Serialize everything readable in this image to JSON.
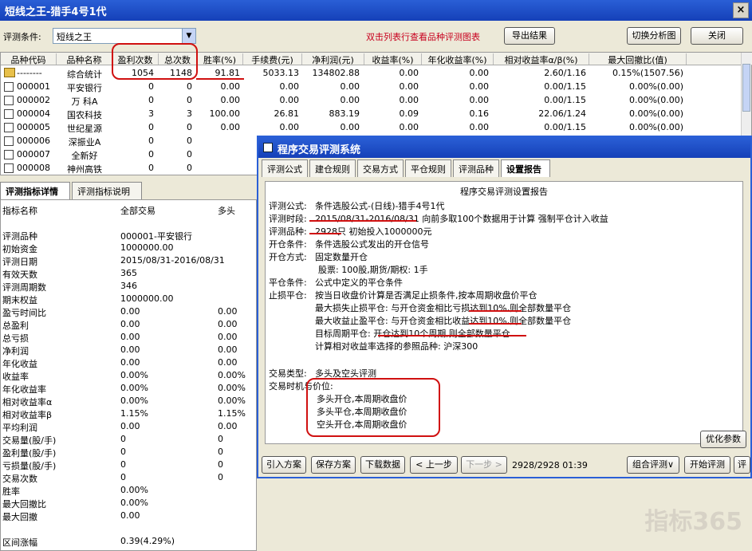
{
  "window": {
    "title": "短线之王-猎手4号1代",
    "close_icon": "×"
  },
  "toolbar": {
    "condition_label": "评测条件:",
    "condition_value": "短线之王",
    "hint": "双击列表行查看品种评测图表",
    "export_label": "导出结果",
    "switch_label": "切换分析图",
    "close_label": "关闭"
  },
  "grid": {
    "headers": [
      "品种代码",
      "品种名称",
      "盈利次数",
      "总次数",
      "胜率(%)",
      "手续费(元)",
      "净利润(元)",
      "收益率(%)",
      "年化收益率(%)",
      "相对收益率α/β(%)",
      "最大回撤比(值)"
    ],
    "rows": [
      [
        "--------",
        "综合统计",
        "1054",
        "1148",
        "91.81",
        "5033.13",
        "134802.88",
        "0.00",
        "0.00",
        "2.60/1.16",
        "0.15%(1507.56)"
      ],
      [
        "000001",
        "平安银行",
        "0",
        "0",
        "0.00",
        "0.00",
        "0.00",
        "0.00",
        "0.00",
        "0.00/1.15",
        "0.00%(0.00)"
      ],
      [
        "000002",
        "万 科A",
        "0",
        "0",
        "0.00",
        "0.00",
        "0.00",
        "0.00",
        "0.00",
        "0.00/1.15",
        "0.00%(0.00)"
      ],
      [
        "000004",
        "国农科技",
        "3",
        "3",
        "100.00",
        "26.81",
        "883.19",
        "0.09",
        "0.16",
        "22.06/1.24",
        "0.00%(0.00)"
      ],
      [
        "000005",
        "世纪星源",
        "0",
        "0",
        "0.00",
        "0.00",
        "0.00",
        "0.00",
        "0.00",
        "0.00/1.15",
        "0.00%(0.00)"
      ],
      [
        "000006",
        "深振业A",
        "0",
        "0",
        "",
        "",
        "",
        "",
        "",
        "",
        ""
      ],
      [
        "000007",
        "全新好",
        "0",
        "0",
        "",
        "",
        "",
        "",
        "",
        "",
        ""
      ],
      [
        "000008",
        "神州高铁",
        "0",
        "0",
        "",
        "",
        "",
        "",
        "",
        "",
        ""
      ]
    ]
  },
  "lower_tabs": [
    "评测指标详情",
    "评测指标说明"
  ],
  "detail": {
    "headers": [
      "指标名称",
      "全部交易",
      "多头"
    ],
    "rows": [
      [
        "评测品种",
        "000001-平安银行",
        ""
      ],
      [
        "初始资金",
        "1000000.00",
        ""
      ],
      [
        "评测日期",
        "2015/08/31-2016/08/31",
        ""
      ],
      [
        "有效天数",
        "365",
        ""
      ],
      [
        "评测周期数",
        "346",
        ""
      ],
      [
        "期末权益",
        "1000000.00",
        ""
      ],
      [
        "盈亏时间比",
        "0.00",
        "0.00"
      ],
      [
        "总盈利",
        "0.00",
        "0.00"
      ],
      [
        "总亏损",
        "0.00",
        "0.00"
      ],
      [
        "净利润",
        "0.00",
        "0.00"
      ],
      [
        "年化收益",
        "0.00",
        "0.00"
      ],
      [
        "收益率",
        "0.00%",
        "0.00%"
      ],
      [
        "年化收益率",
        "0.00%",
        "0.00%"
      ],
      [
        "相对收益率α",
        "0.00%",
        "0.00%"
      ],
      [
        "相对收益率β",
        "1.15%",
        "1.15%"
      ],
      [
        "平均利润",
        "0.00",
        "0.00"
      ],
      [
        "交易量(股/手)",
        "0",
        "0"
      ],
      [
        "盈利量(股/手)",
        "0",
        "0"
      ],
      [
        "亏损量(股/手)",
        "0",
        "0"
      ],
      [
        "交易次数",
        "0",
        "0"
      ],
      [
        "胜率",
        "0.00%",
        ""
      ],
      [
        "最大回撤比",
        "0.00%",
        ""
      ],
      [
        "最大回撤",
        "0.00",
        ""
      ],
      [
        "",
        "",
        ""
      ],
      [
        "区间涨幅",
        "0.39(4.29%)",
        ""
      ]
    ]
  },
  "dialog": {
    "title": "程序交易评测系统",
    "tabs": [
      "评测公式",
      "建仓规则",
      "交易方式",
      "平仓规则",
      "评测品种",
      "设置报告"
    ],
    "report": {
      "heading": "程序交易评测设置报告",
      "lines": [
        [
          "评测公式:",
          "条件选股公式-(日线)-猎手4号1代"
        ],
        [
          "评测时段:",
          "2015/08/31-2016/08/31  向前多取100个数据用于计算 强制平仓计入收益"
        ],
        [
          "评测品种:",
          "2928只  初始投入1000000元"
        ],
        [
          "开仓条件:",
          "条件选股公式发出的开仓信号"
        ],
        [
          "开仓方式:",
          "固定数量开仓"
        ],
        [
          "",
          "股票: 100股,期货/期权: 1手"
        ],
        [
          "平仓条件:",
          "公式中定义的平仓条件"
        ],
        [
          "止损平仓:",
          "按当日收盘价计算是否满足止损条件,按本周期收盘价平仓"
        ],
        [
          "",
          "最大损失止损平仓: 与开仓资金相比亏损达到10%,则全部数量平仓"
        ],
        [
          "",
          "最大收益止盈平仓: 与开仓资金相比收益达到10%,则全部数量平仓"
        ],
        [
          "",
          "目标周期平仓: 开仓达到10个周期,则全部数量平仓"
        ],
        [
          "",
          "计算相对收益率选择的参照品种: 沪深300"
        ],
        [
          "交易类型:",
          "多头及空头评测"
        ],
        [
          "交易时机与价位:",
          ""
        ],
        [
          "",
          "多头开仓,本周期收盘价"
        ],
        [
          "",
          "多头平仓,本周期收盘价"
        ],
        [
          "",
          "空头开仓,本周期收盘价"
        ]
      ]
    },
    "optimize_label": "优化参数",
    "buttons": [
      "引入方案",
      "保存方案",
      "下载数据",
      "< 上一步",
      "下一步 >"
    ],
    "progress": "2928/2928  01:39",
    "right_buttons": [
      "组合评测∨",
      "开始评测",
      "评"
    ]
  },
  "watermark": "指标365"
}
